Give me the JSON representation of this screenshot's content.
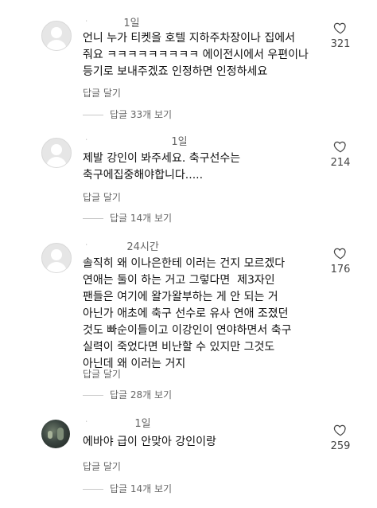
{
  "comments": [
    {
      "username": "ㆍ",
      "time": "1일",
      "text": "언니 누가 티켓을 호텔 지하주차장이나 집에서\n줘요 ㅋㅋㅋㅋㅋㅋㅋㅋㅋ 에이전시에서 우편이나\n등기로 보내주겠죠 인정하면 인정하세요",
      "reply_label": "답글 달기",
      "view_replies": "답글 33개 보기",
      "likes": "321",
      "avatar": "default-profile-icon"
    },
    {
      "username": "ㆍ",
      "time": "1일",
      "text": "제발 강인이 봐주세요. 축구선수는\n축구에집중해야합니다.....",
      "reply_label": "답글 달기",
      "view_replies": "답글 14개 보기",
      "likes": "214",
      "avatar": "default-profile-icon"
    },
    {
      "username": "ㆍ",
      "time": "24시간",
      "text": "솔직히 왜 이나은한테 이러는 건지 모르겠다\n연애는 둘이 하는 거고 그렇다면  제3자인\n팬들은 여기에 왈가왈부하는 게 안 되는 거\n아닌가 애초에 축구 선수로 유사 연애 조졌던\n것도 빠순이들이고 이강인이 연야하면서 축구\n실력이 죽었다면 비난할 수 있지만 그것도\n아닌데 왜 이러는 거지",
      "reply_label": "답글 달기",
      "view_replies": "답글 28개 보기",
      "likes": "176",
      "avatar": "default-profile-icon"
    },
    {
      "username": "ㆍ",
      "time": "1일",
      "text": "에바야 급이 안맞아 강인이랑",
      "reply_label": "답글 달기",
      "view_replies": "답글 14개 보기",
      "likes": "259",
      "avatar": "photo-avatar"
    }
  ],
  "colors": {
    "text": "#111111",
    "muted": "#666666",
    "divider": "#c8c8c8"
  }
}
